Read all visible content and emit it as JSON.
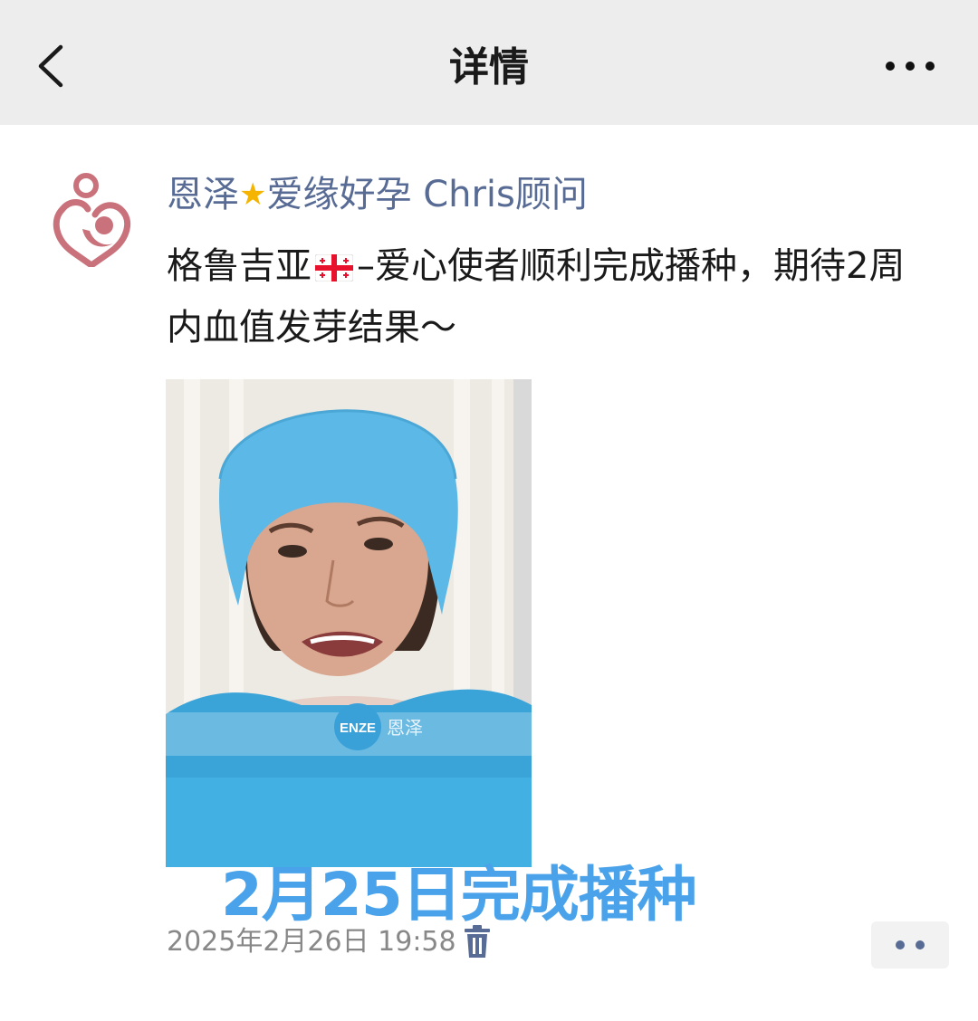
{
  "header": {
    "title": "详情",
    "back_icon": "chevron-left-icon",
    "more_icon": "more-horizontal-icon"
  },
  "post": {
    "author_name_part1": "恩泽",
    "author_name_part2": "爱缘好孕 Chris顾问",
    "author_name_color": "#576b95",
    "text_before_flag": "格鲁吉亚",
    "text_after_flag": "–爱心使者顺利完成播种，期待2周内血值发芽结果～",
    "photo_overlay_caption": "2月25日完成播种",
    "photo_watermark_brand": "ENZE",
    "photo_watermark_text": "恩泽",
    "timestamp": "2025年2月26日 19:58",
    "caption_color": "#4aa3ea"
  }
}
